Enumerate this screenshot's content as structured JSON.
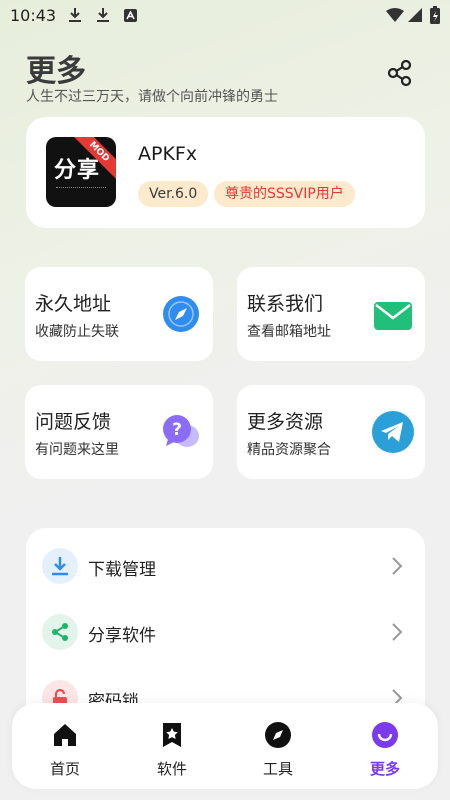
{
  "status_bar": {
    "time": "10:43"
  },
  "header": {
    "title": "更多",
    "subtitle": "人生不过三万天，请做个向前冲锋的勇士"
  },
  "app_card": {
    "logo_text": "分享",
    "logo_ribbon": "MOD",
    "name": "APKFx",
    "version_badge": "Ver.6.0",
    "vip_badge": "尊贵的SSSVIP用户"
  },
  "grid": [
    {
      "title": "永久地址",
      "subtitle": "收藏防止失联",
      "icon": "compass-icon"
    },
    {
      "title": "联系我们",
      "subtitle": "查看邮箱地址",
      "icon": "mail-icon"
    },
    {
      "title": "问题反馈",
      "subtitle": "有问题来这里",
      "icon": "question-chat-icon"
    },
    {
      "title": "更多资源",
      "subtitle": "精品资源聚合",
      "icon": "telegram-icon"
    }
  ],
  "list": [
    {
      "label": "下载管理",
      "icon": "download-icon"
    },
    {
      "label": "分享软件",
      "icon": "share-icon"
    },
    {
      "label": "密码锁",
      "icon": "lock-icon"
    }
  ],
  "nav": [
    {
      "label": "首页",
      "icon": "home-icon"
    },
    {
      "label": "软件",
      "icon": "bookmark-star-icon"
    },
    {
      "label": "工具",
      "icon": "compass-icon"
    },
    {
      "label": "更多",
      "icon": "smile-icon",
      "active": true
    }
  ],
  "colors": {
    "accent": "#7c3aed",
    "vip_red": "#e53935",
    "badge_bg": "#fde9cc"
  }
}
